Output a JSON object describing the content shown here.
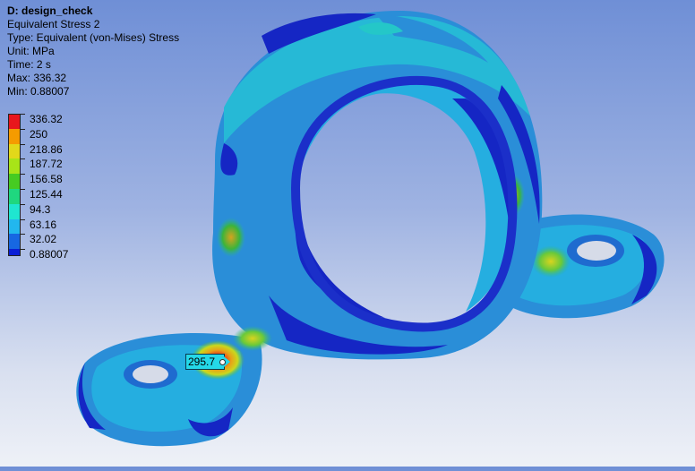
{
  "info": {
    "title": "D: design_check",
    "result_name": "Equivalent Stress 2",
    "type": "Type: Equivalent (von-Mises) Stress",
    "unit": "Unit: MPa",
    "time": "Time: 2 s",
    "max": "Max: 336.32",
    "min": "Min: 0.88007"
  },
  "legend": {
    "labels": [
      "336.32",
      "250",
      "218.86",
      "187.72",
      "156.58",
      "125.44",
      "94.3",
      "63.16",
      "32.02",
      "0.88007"
    ],
    "colors": [
      "#e8161c",
      "#f59b00",
      "#e2d81a",
      "#a8e418",
      "#46cb22",
      "#1fd77f",
      "#1fe6d0",
      "#22b7ee",
      "#1767e2"
    ],
    "bottom_color": "#0a1ed6"
  },
  "probe": {
    "value": "295.7"
  },
  "colors": {
    "deep_blue": "#1526c4",
    "blue": "#1d6fd8",
    "light_blue": "#2aa3e6",
    "cyan": "#24c7c8",
    "green": "#3cb43a",
    "yellow": "#d8cf1e",
    "red": "#d81212"
  }
}
